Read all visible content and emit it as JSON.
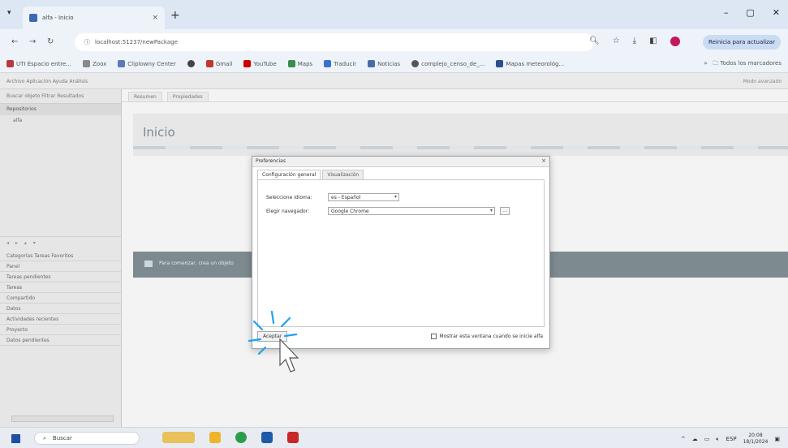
{
  "browser": {
    "tab_title": "alfa - Inicio",
    "url": "localhost:51237/newPackage",
    "update_label": "Reinicia para actualizar",
    "bookmarks": [
      {
        "label": "UTI Espacio entre...",
        "color": "#b83b3b"
      },
      {
        "label": "Zoox",
        "color": "#8a8a8a"
      },
      {
        "label": "Cliplowny Center",
        "color": "#5a7bb5"
      },
      {
        "label": "",
        "color": "#444"
      },
      {
        "label": "Gmail",
        "color": "#c0392b"
      },
      {
        "label": "YouTube",
        "color": "#cc0000"
      },
      {
        "label": "Maps",
        "color": "#3b8c4a"
      },
      {
        "label": "Traducir",
        "color": "#3a6fd0"
      },
      {
        "label": "Noticias",
        "color": "#4a6aa5"
      },
      {
        "label": "complejo_censo_de_...",
        "color": "#555"
      },
      {
        "label": "Mapas meteorológ...",
        "color": "#2b4f8c"
      }
    ],
    "bookmarks_right": "Todos los marcadores"
  },
  "app": {
    "menu_text": "Archivo  Aplicación  Ayuda  Análisis",
    "right_text": "Modo avanzado",
    "sidebar_head": "Buscar objeto  Filtrar  Resultados",
    "sidebar_section": "Repositorios",
    "sidebar_item": "alfa",
    "sidebar_tools": "◂ ▸ ▴ ▾",
    "sidebar_tabs": "Categorías  Tareas  Favoritos",
    "sidebar_list": [
      "Panel",
      "Tareas pendientes",
      "Tareas",
      "Compartido",
      "Datos",
      "Actividades recientes",
      "Proyecto",
      "Datos pendientes"
    ],
    "content_tabs": [
      "Resumen",
      "Propiedades"
    ],
    "page_title": "Inicio",
    "banner_text": "Para comenzar, crea un objeto"
  },
  "dialog": {
    "title": "Preferencias",
    "tabs": [
      "Configuración general",
      "Visualización"
    ],
    "language_label": "Seleccione idioma:",
    "language_value": "es - Español",
    "browser_label": "Elegir navegador:",
    "browser_value": "Google Chrome",
    "ok_label": "Aceptar",
    "checkbox_label": "Mostrar esta ventana cuando se inicie alfa"
  },
  "taskbar": {
    "search_placeholder": "Buscar",
    "lang": "ESP",
    "time": "20:08",
    "date": "18/1/2024"
  }
}
